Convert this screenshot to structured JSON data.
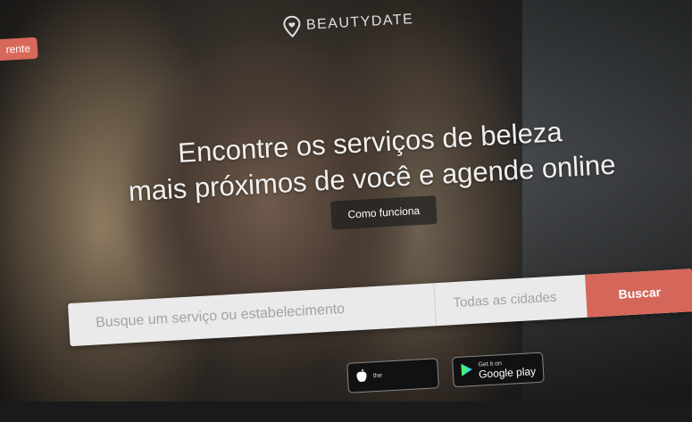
{
  "top_left_button": "rente",
  "brand": {
    "name": "BEAUTYDATE",
    "icon": "location-pin-heart-icon"
  },
  "hero": {
    "line1": "Encontre os serviços de beleza",
    "line2": "mais próximos de você e agende online",
    "how_button": "Como funciona"
  },
  "search": {
    "service_placeholder": "Busque um serviço ou estabelecimento",
    "city_placeholder": "Todas as cidades",
    "submit_label": "Buscar"
  },
  "store_badges": [
    {
      "small": "the",
      "big": "",
      "icon": "apple-icon"
    },
    {
      "small": "Get it on",
      "big": "Google play",
      "icon": "play-store-icon"
    }
  ],
  "colors": {
    "accent": "#d5675a"
  }
}
